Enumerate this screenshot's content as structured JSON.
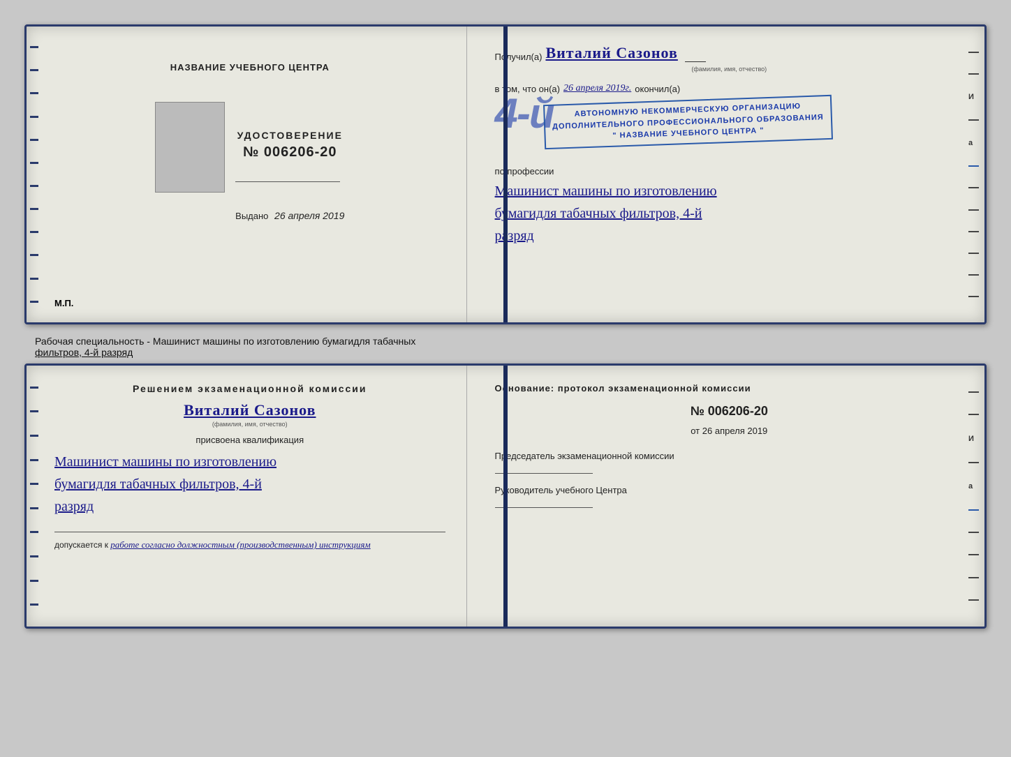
{
  "top_cert": {
    "left": {
      "title": "НАЗВАНИЕ УЧЕБНОГО ЦЕНТРА",
      "udostoverenie_label": "УДОСТОВЕРЕНИЕ",
      "cert_number": "№ 006206-20",
      "vydano_label": "Выдано",
      "vydano_date": "26 апреля 2019",
      "mp_label": "М.П."
    },
    "right": {
      "poluchil_prefix": "Получил(а)",
      "recipient_name": "Виталий Сазонов",
      "fio_caption": "(фамилия, имя, отчество)",
      "vtom_prefix": "в том, что он(a)",
      "vtom_date": "26 апреля 2019г.",
      "okonchil_label": "окончил(а)",
      "stamp_number": "4-й",
      "stamp_line1": "АВТОНОМНУЮ НЕКОММЕРЧЕСКУЮ ОРГАНИЗАЦИЮ",
      "stamp_line2": "ДОПОЛНИТЕЛЬНОГО ПРОФЕССИОНАЛЬНОГО ОБРАЗОВАНИЯ",
      "stamp_line3": "\" НАЗВАНИЕ УЧЕБНОГО ЦЕНТРА \"",
      "po_professii": "по профессии",
      "profession_line1": "Машинист машины по изготовлению",
      "profession_line2": "бумагидля табачных фильтров, 4-й",
      "profession_line3": "разряд"
    }
  },
  "separator": {
    "text_normal": "Рабочая специальность - Машинист машины по изготовлению бумагидля табачных",
    "text_underlined": "фильтров, 4-й разряд"
  },
  "bottom_cert": {
    "left": {
      "resheniem_title": "Решением  экзаменационной  комиссии",
      "name": "Виталий Сазонов",
      "fio_caption": "(фамилия, имя, отчество)",
      "prisvoena_label": "присвоена квалификация",
      "qualification_line1": "Машинист машины по изготовлению",
      "qualification_line2": "бумагидля табачных фильтров, 4-й",
      "qualification_line3": "разряд",
      "dopuskaetsya_prefix": "допускается к",
      "dopuskaetsya_text": "работе согласно должностным (производственным) инструкциям"
    },
    "right": {
      "osnovanie_label": "Основание: протокол экзаменационной  комиссии",
      "protocol_number": "№  006206-20",
      "ot_prefix": "от",
      "ot_date": "26 апреля 2019",
      "predsedatel_label": "Председатель экзаменационной комиссии",
      "rukovoditel_label": "Руководитель учебного Центра"
    }
  }
}
